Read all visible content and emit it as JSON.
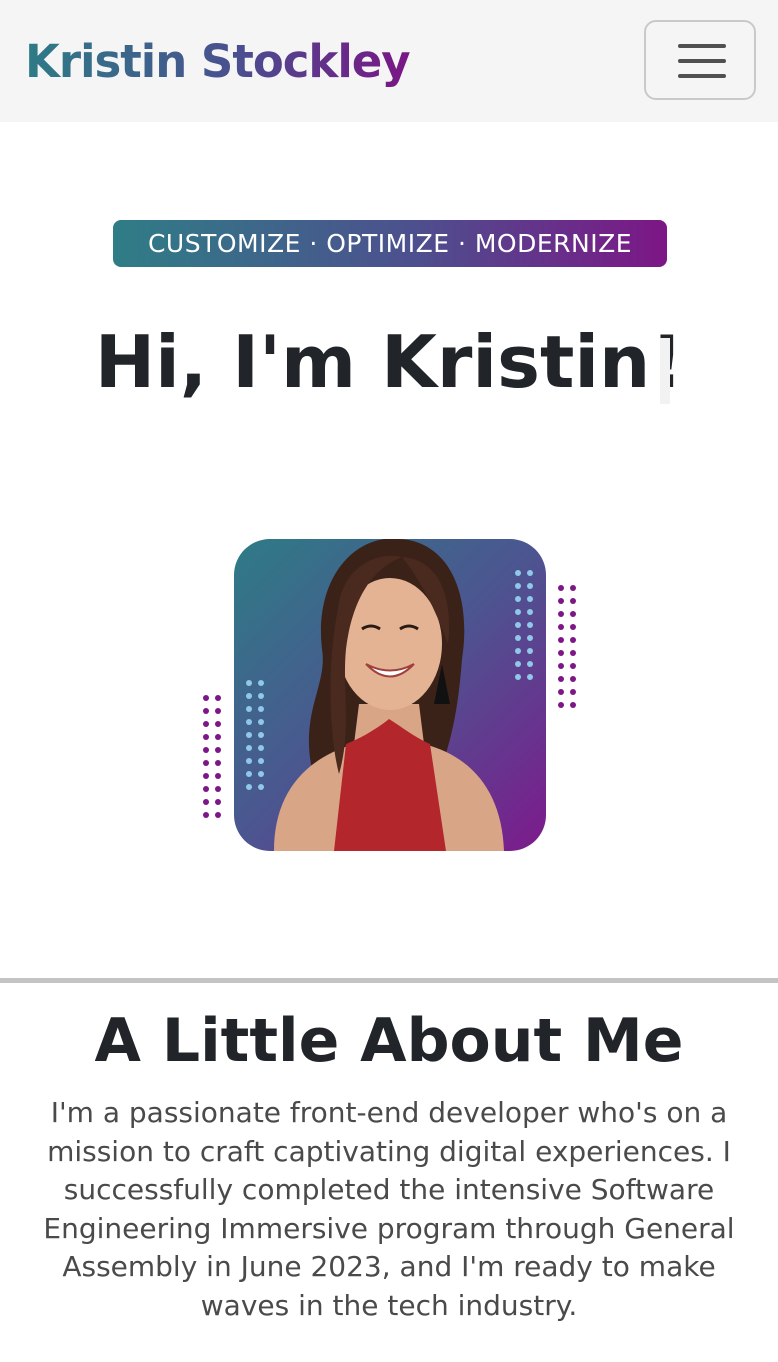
{
  "navbar": {
    "brand": "Kristin Stockley",
    "brand_gradient": [
      "#2e7b86",
      "#4a4f8f",
      "#7a1585"
    ],
    "menu_icon": "hamburger-icon"
  },
  "hero": {
    "tagline": "CUSTOMIZE · OPTIMIZE · MODERNIZE",
    "title": "Hi, I'm Kristin!",
    "portrait_gradient": [
      "#2e7b86",
      "#4c5590",
      "#7d1a8c"
    ],
    "dot_colors": {
      "purple": "#7d1686",
      "light_blue": "#8fc8e8"
    }
  },
  "about": {
    "title": "A Little About Me",
    "paragraph_1": " I'm a passionate front-end developer who's on a mission to craft captivating digital experiences. I successfully completed the intensive Software Engineering Immersive program through General Assembly in June 2023, and I'm ready to make waves in the tech industry.",
    "paragraph_2": ""
  }
}
